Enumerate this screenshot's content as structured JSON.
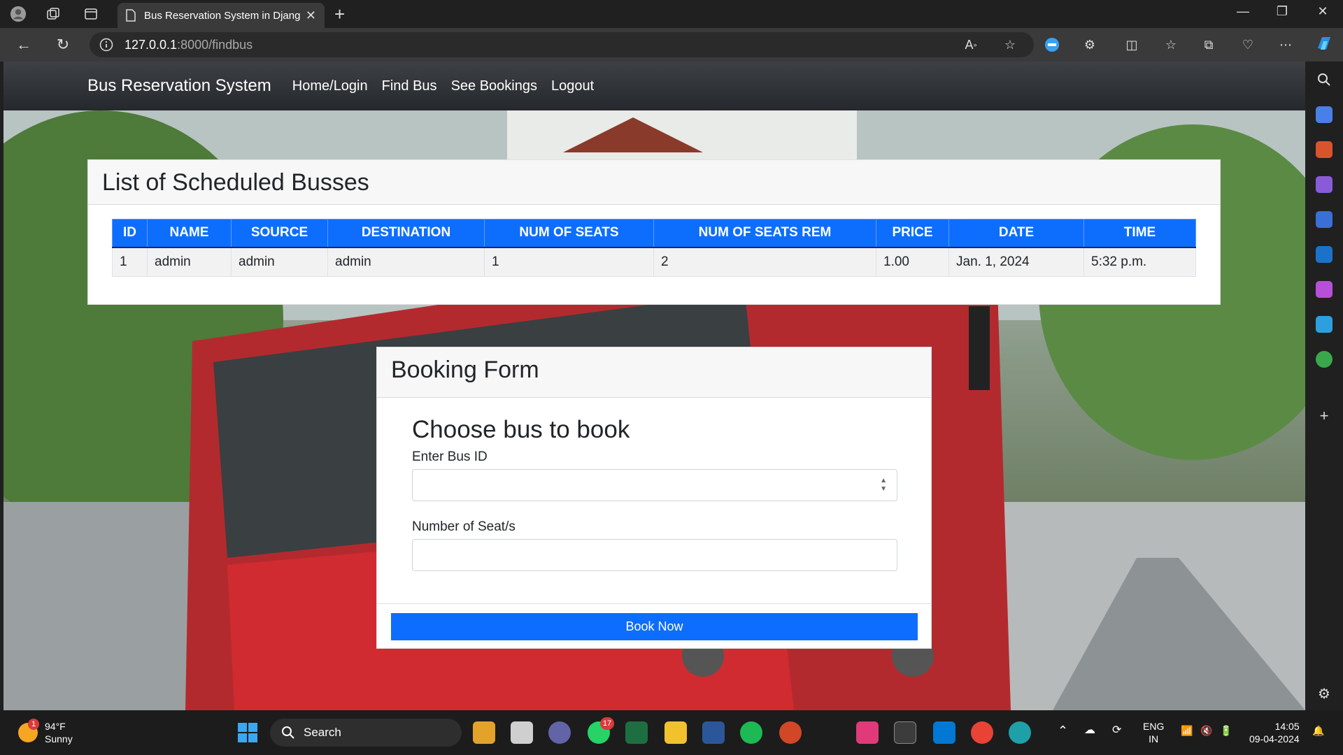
{
  "browser": {
    "tab_title": "Bus Reservation System in Djang",
    "url_host": "127.0.0.1",
    "url_path": ":8000/findbus"
  },
  "navbar": {
    "brand": "Bus Reservation System",
    "links": [
      "Home/Login",
      "Find Bus",
      "See Bookings",
      "Logout"
    ]
  },
  "schedule": {
    "title": "List of Scheduled Busses",
    "columns": [
      "ID",
      "NAME",
      "SOURCE",
      "DESTINATION",
      "NUM OF SEATS",
      "NUM OF SEATS REM",
      "PRICE",
      "DATE",
      "TIME"
    ],
    "rows": [
      [
        "1",
        "admin",
        "admin",
        "admin",
        "1",
        "2",
        "1.00",
        "Jan. 1, 2024",
        "5:32 p.m."
      ]
    ]
  },
  "booking": {
    "header": "Booking Form",
    "subtitle": "Choose bus to book",
    "bus_id_label": "Enter Bus ID",
    "bus_id_value": "",
    "seats_label": "Number of Seat/s",
    "seats_value": "",
    "submit_label": "Book Now"
  },
  "taskbar": {
    "weather_temp": "94°F",
    "weather_desc": "Sunny",
    "weather_badge": "1",
    "search_label": "Search",
    "whatsapp_badge": "17",
    "lang_top": "ENG",
    "lang_bottom": "IN",
    "time": "14:05",
    "date": "09-04-2024"
  }
}
